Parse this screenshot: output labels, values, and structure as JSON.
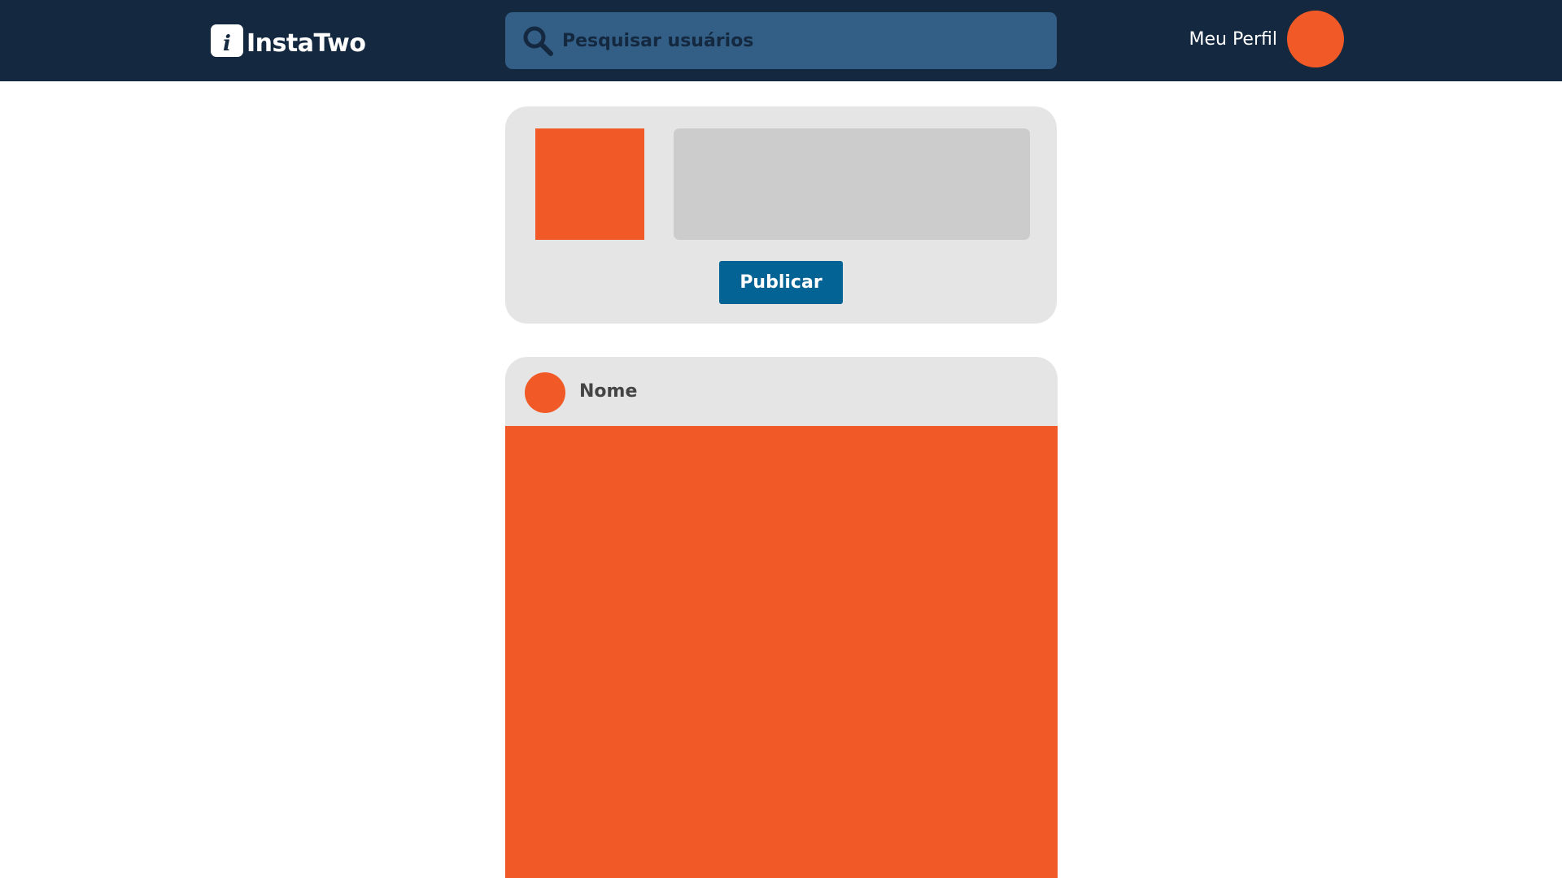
{
  "header": {
    "logo_letter": "i",
    "logo_text": "InstaTwo",
    "search_placeholder": "Pesquisar usuários",
    "profile_label": "Meu Perfil"
  },
  "composer": {
    "publish_label": "Publicar"
  },
  "feed": {
    "posts": [
      {
        "author": "Nome"
      }
    ]
  },
  "colors": {
    "navbar": "#14283f",
    "search_bg": "#335e86",
    "accent_orange": "#f15a27",
    "button_blue": "#036394",
    "card_bg": "#e5e5e5",
    "textarea_bg": "#cccccc"
  },
  "icons": {
    "search": "search-icon"
  }
}
